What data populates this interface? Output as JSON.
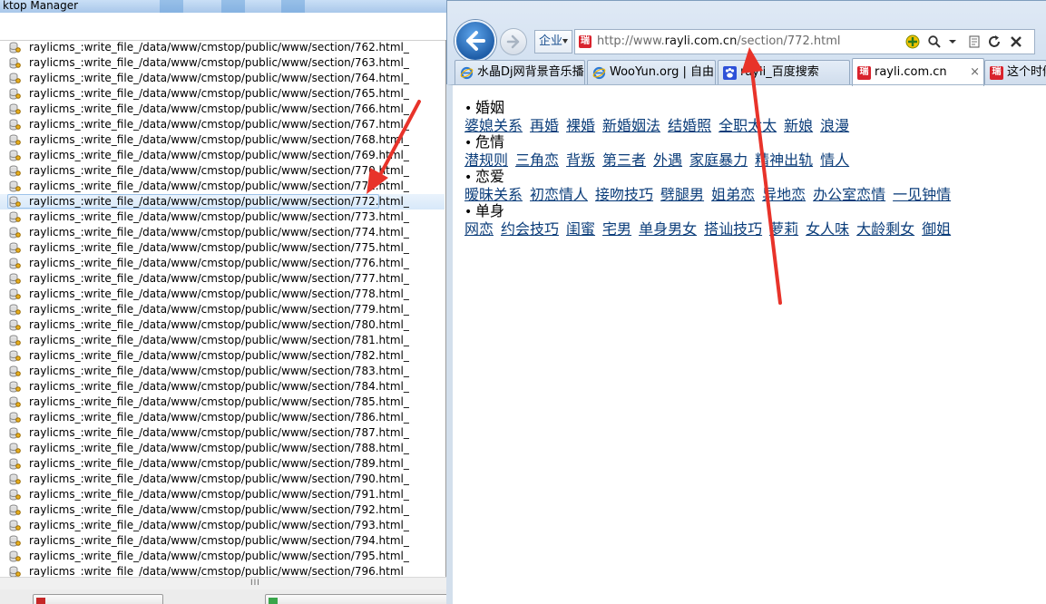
{
  "left_window": {
    "title": "ktop Manager",
    "files": [
      "raylicms_:write_file_/data/www/cmstop/public/www/section/762.html_",
      "raylicms_:write_file_/data/www/cmstop/public/www/section/763.html_",
      "raylicms_:write_file_/data/www/cmstop/public/www/section/764.html_",
      "raylicms_:write_file_/data/www/cmstop/public/www/section/765.html_",
      "raylicms_:write_file_/data/www/cmstop/public/www/section/766.html_",
      "raylicms_:write_file_/data/www/cmstop/public/www/section/767.html_",
      "raylicms_:write_file_/data/www/cmstop/public/www/section/768.html_",
      "raylicms_:write_file_/data/www/cmstop/public/www/section/769.html_",
      "raylicms_:write_file_/data/www/cmstop/public/www/section/770.html_",
      "raylicms_:write_file_/data/www/cmstop/public/www/section/771.html_",
      "raylicms_:write_file_/data/www/cmstop/public/www/section/772.html_",
      "raylicms_:write_file_/data/www/cmstop/public/www/section/773.html_",
      "raylicms_:write_file_/data/www/cmstop/public/www/section/774.html_",
      "raylicms_:write_file_/data/www/cmstop/public/www/section/775.html_",
      "raylicms_:write_file_/data/www/cmstop/public/www/section/776.html_",
      "raylicms_:write_file_/data/www/cmstop/public/www/section/777.html_",
      "raylicms_:write_file_/data/www/cmstop/public/www/section/778.html_",
      "raylicms_:write_file_/data/www/cmstop/public/www/section/779.html_",
      "raylicms_:write_file_/data/www/cmstop/public/www/section/780.html_",
      "raylicms_:write_file_/data/www/cmstop/public/www/section/781.html_",
      "raylicms_:write_file_/data/www/cmstop/public/www/section/782.html_",
      "raylicms_:write_file_/data/www/cmstop/public/www/section/783.html_",
      "raylicms_:write_file_/data/www/cmstop/public/www/section/784.html_",
      "raylicms_:write_file_/data/www/cmstop/public/www/section/785.html_",
      "raylicms_:write_file_/data/www/cmstop/public/www/section/786.html_",
      "raylicms_:write_file_/data/www/cmstop/public/www/section/787.html_",
      "raylicms_:write_file_/data/www/cmstop/public/www/section/788.html_",
      "raylicms_:write_file_/data/www/cmstop/public/www/section/789.html_",
      "raylicms_:write_file_/data/www/cmstop/public/www/section/790.html_",
      "raylicms_:write_file_/data/www/cmstop/public/www/section/791.html_",
      "raylicms_:write_file_/data/www/cmstop/public/www/section/792.html_",
      "raylicms_:write_file_/data/www/cmstop/public/www/section/793.html_",
      "raylicms_:write_file_/data/www/cmstop/public/www/section/794.html_",
      "raylicms_:write_file_/data/www/cmstop/public/www/section/795.html_",
      "raylicms_:write_file_/data/www/cmstop/public/www/section/796.html_"
    ],
    "selected_index": 10,
    "scroll_grip": "III"
  },
  "browser": {
    "company_label": "企业",
    "url_prefix": "http://www.",
    "url_domain": "rayli.com.cn",
    "url_path": "/section/772.html",
    "site_logo": "瑞",
    "tabs": [
      {
        "label": "水晶Dj网背景音乐播...",
        "icon": "ie-icon"
      },
      {
        "label": "WooYun.org | 自由...",
        "icon": "ie-icon"
      },
      {
        "label": "rayli_百度搜索",
        "icon": "baidu-paw-icon"
      },
      {
        "label": "rayli.com.cn",
        "icon": "rayli-logo-icon",
        "active": true,
        "close": "×"
      },
      {
        "label": "这个时候",
        "icon": "rayli-logo-icon"
      }
    ],
    "categories": [
      {
        "title": "婚姻",
        "links": [
          "婆媳关系",
          "再婚",
          "裸婚",
          "新婚姻法",
          "结婚照",
          "全职太太",
          "新娘",
          "浪漫"
        ]
      },
      {
        "title": "危情",
        "links": [
          "潜规则",
          "三角恋",
          "背叛",
          "第三者",
          "外遇",
          "家庭暴力",
          "精神出轨",
          "情人"
        ]
      },
      {
        "title": "恋爱",
        "links": [
          "暧昧关系",
          "初恋情人",
          "接吻技巧",
          "劈腿男",
          "姐弟恋",
          "异地恋",
          "办公室恋情",
          "一见钟情"
        ]
      },
      {
        "title": "单身",
        "links": [
          "网恋",
          "约会技巧",
          "闺蜜",
          "宅男",
          "单身男女",
          "搭讪技巧",
          "萝莉",
          "女人味",
          "大龄剩女",
          "御姐"
        ]
      }
    ],
    "bullet": "•"
  },
  "colors": {
    "arrow": "#e8332a",
    "link": "#0b3d7a",
    "accent": "#1f5ea8"
  }
}
